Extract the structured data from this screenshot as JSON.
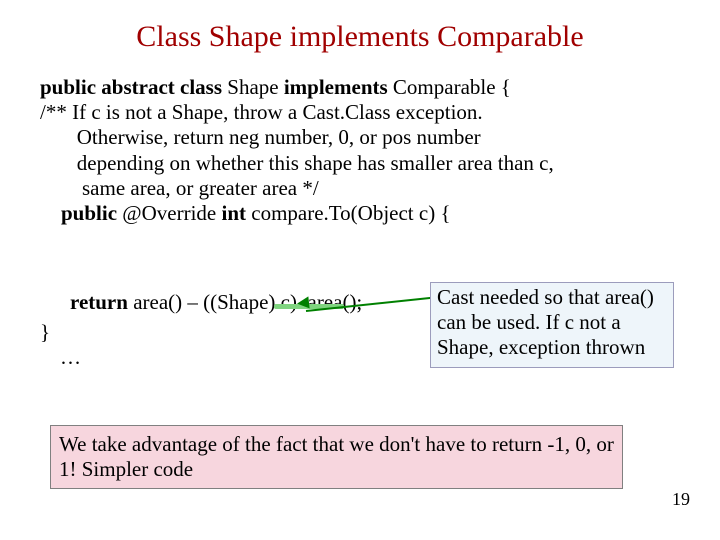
{
  "title": "Class Shape implements Comparable",
  "code": {
    "l1a": "public abstract class",
    "l1b": " Shape ",
    "l1c": "implements",
    "l1d": " Comparable {",
    "l2": "/** If c is not a Shape, throw a Cast.Class exception.",
    "l3": "       Otherwise, return neg number, 0, or pos number",
    "l4": "       depending on whether this shape has smaller area than c,",
    "l5": "        same area, or greater area */",
    "l6a": "    public",
    "l6b": " @Override ",
    "l6c": "int",
    "l6d": " compare.To(Object c) {",
    "ret_a": "return",
    "ret_b": " area() – ((Shape) c). area();",
    "close": "}",
    "ell": "…"
  },
  "annotation": "Cast needed so that area() can be used. If c not a Shape, exception thrown",
  "pinkbox": "We take advantage of the fact that we don't have to return -1, 0, or 1! Simpler code",
  "pagenum": "19"
}
